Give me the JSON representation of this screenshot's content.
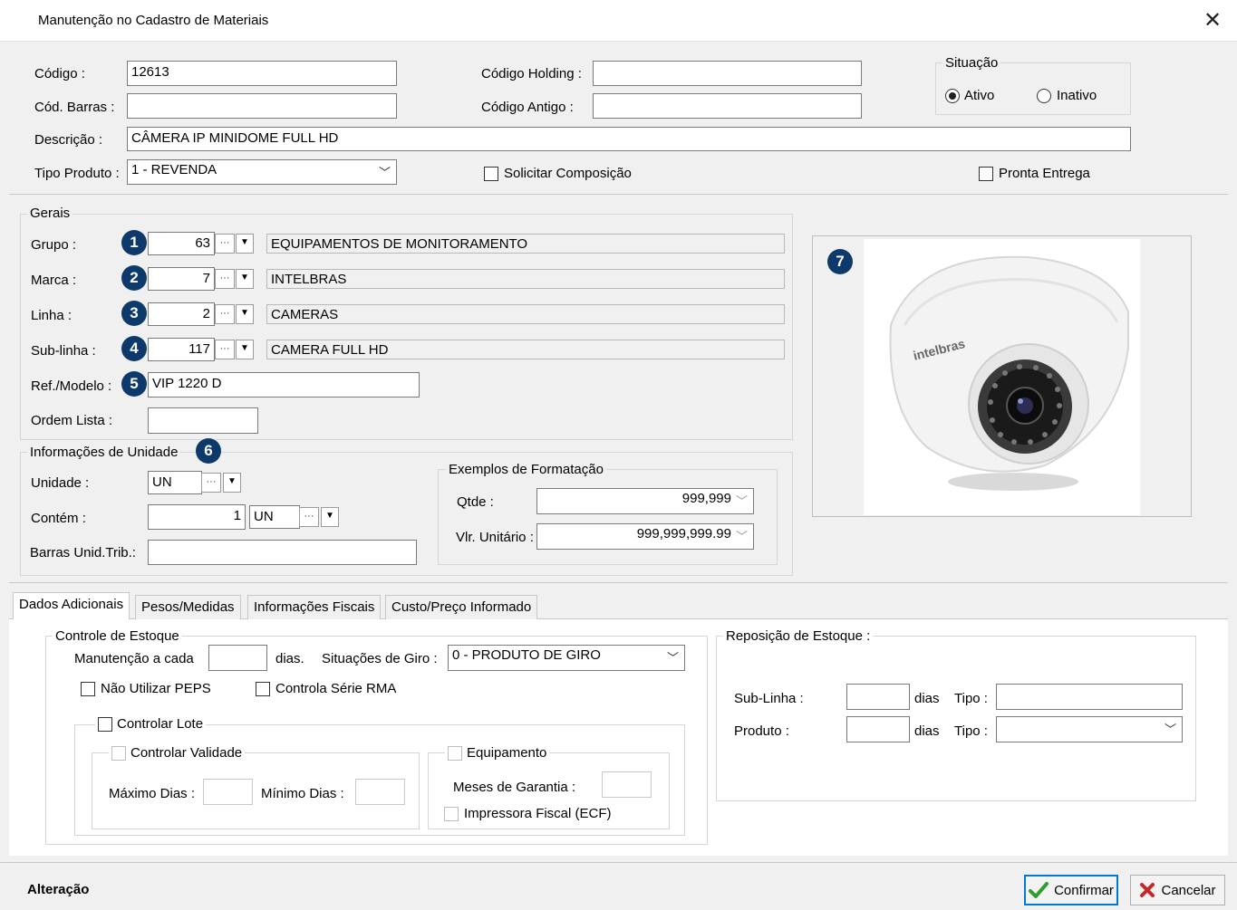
{
  "window": {
    "title": "Manutenção no Cadastro de Materiais",
    "close_glyph": "✕"
  },
  "header": {
    "codigo_label": "Código :",
    "codigo_value": "12613",
    "cod_barras_label": "Cód. Barras :",
    "cod_barras_value": "",
    "descricao_label": "Descrição :",
    "descricao_value": "CÂMERA IP MINIDOME FULL HD",
    "tipo_produto_label": "Tipo Produto :",
    "tipo_produto_value": "1 - REVENDA",
    "codigo_holding_label": "Código Holding :",
    "codigo_holding_value": "",
    "codigo_antigo_label": "Código Antigo :",
    "codigo_antigo_value": "",
    "solicitar_composicao_label": "Solicitar Composição",
    "pronta_entrega_label": "Pronta Entrega",
    "situacao": {
      "legend": "Situação",
      "ativo_label": "Ativo",
      "inativo_label": "Inativo",
      "selected": "Ativo"
    }
  },
  "gerais": {
    "legend": "Gerais",
    "grupo": {
      "badge": "1",
      "label": "Grupo :",
      "code": "63",
      "desc": "EQUIPAMENTOS DE MONITORAMENTO"
    },
    "marca": {
      "badge": "2",
      "label": "Marca :",
      "code": "7",
      "desc": "INTELBRAS"
    },
    "linha": {
      "badge": "3",
      "label": "Linha :",
      "code": "2",
      "desc": "CAMERAS"
    },
    "sublinha": {
      "badge": "4",
      "label": "Sub-linha :",
      "code": "117",
      "desc": "CAMERA FULL HD"
    },
    "ref_modelo": {
      "badge": "5",
      "label": "Ref./Modelo :",
      "value": "VIP 1220 D"
    },
    "ordem_lista": {
      "label": "Ordem Lista :",
      "value": ""
    }
  },
  "unidade": {
    "legend": "Informações de Unidade",
    "badge": "6",
    "unidade_label": "Unidade :",
    "unidade_value": "UN",
    "contem_label": "Contém :",
    "contem_qty": "1",
    "contem_unit": "UN",
    "barras_label": "Barras Unid.Trib.:",
    "barras_value": "",
    "exemplos": {
      "legend": "Exemplos de Formatação",
      "qtde_label": "Qtde :",
      "qtde_value": "999,999",
      "vlr_label": "Vlr. Unitário :",
      "vlr_value": "999,999,999.99"
    }
  },
  "image_panel": {
    "badge": "7",
    "brand_text": "intelbras"
  },
  "tabs": [
    {
      "label": "Dados Adicionais",
      "active": true
    },
    {
      "label": "Pesos/Medidas",
      "active": false
    },
    {
      "label": "Informações Fiscais",
      "active": false
    },
    {
      "label": "Custo/Preço Informado",
      "active": false
    }
  ],
  "controle_estoque": {
    "legend": "Controle de Estoque",
    "manutencao_label": "Manutenção a cada",
    "manutencao_value": "",
    "dias_label": "dias.",
    "situacoes_giro_label": "Situações de Giro :",
    "situacoes_giro_value": "0 - PRODUTO DE GIRO",
    "nao_utilizar_peps_label": "Não Utilizar PEPS",
    "controla_serie_rma_label": "Controla Série RMA",
    "controlar_lote_label": "Controlar Lote",
    "controlar_validade_label": "Controlar Validade",
    "maximo_dias_label": "Máximo Dias :",
    "minimo_dias_label": "Mínimo Dias :",
    "equipamento_label": "Equipamento",
    "meses_garantia_label": "Meses de Garantia :",
    "impressora_fiscal_label": "Impressora Fiscal (ECF)"
  },
  "reposicao": {
    "legend": "Reposição de Estoque :",
    "sublinha_label": "Sub-Linha :",
    "produto_label": "Produto :",
    "dias_label": "dias",
    "tipo_label": "Tipo :"
  },
  "footer": {
    "mode": "Alteração",
    "confirmar_label": "Confirmar",
    "cancelar_label": "Cancelar"
  },
  "colors": {
    "badge": "#0d3a6b",
    "confirm_check": "#2e9e2e",
    "cancel_x": "#c62828",
    "focus": "#0078d7"
  }
}
